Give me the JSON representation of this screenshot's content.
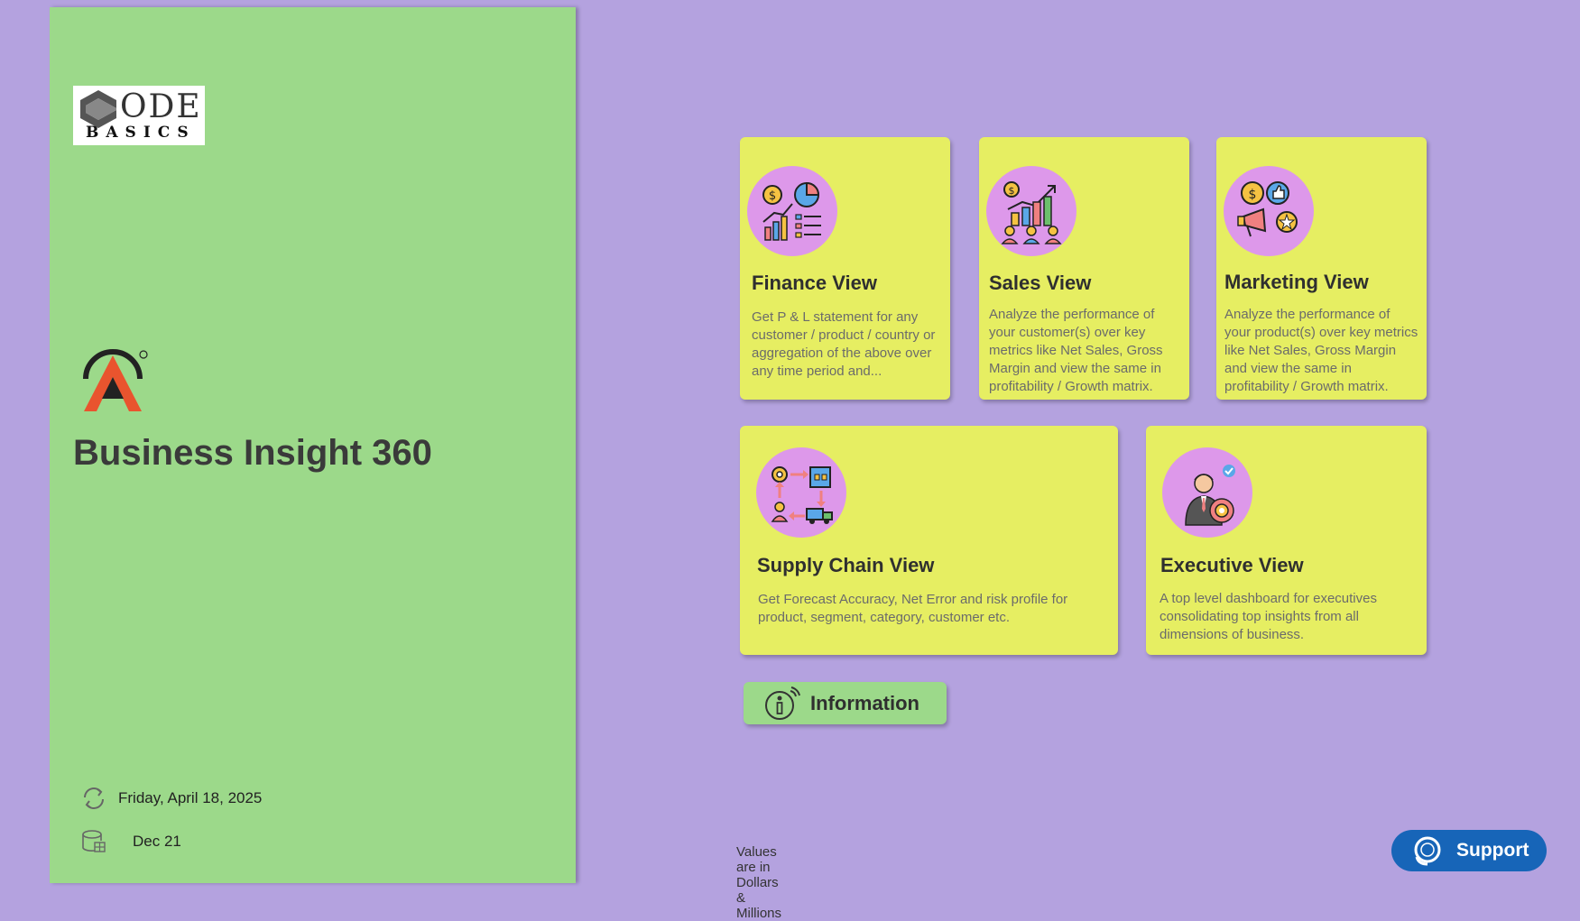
{
  "sidebar": {
    "logo": {
      "line1": "ODE",
      "line2": "BASICS"
    },
    "app_title": "Business Insight 360",
    "refresh_date": "Friday, April 18, 2025",
    "data_date": "Dec 21"
  },
  "cards": {
    "finance": {
      "title": "Finance View",
      "desc": "Get P & L statement for any customer / product / country or aggregation of the above over any time period and...",
      "icon": "finance-chart-icon"
    },
    "sales": {
      "title": "Sales View",
      "desc": "Analyze the performance of your customer(s) over key metrics like Net Sales, Gross Margin and view the same in profitability / Growth matrix.",
      "icon": "sales-growth-icon"
    },
    "marketing": {
      "title": "Marketing View",
      "desc": "Analyze the performance of your product(s) over key metrics like Net Sales, Gross Margin and view the same in profitability / Growth matrix.",
      "icon": "marketing-megaphone-icon"
    },
    "supply_chain": {
      "title": "Supply Chain View",
      "desc": "Get Forecast Accuracy, Net Error and risk profile for product, segment, category, customer etc.",
      "icon": "supply-chain-icon"
    },
    "executive": {
      "title": "Executive View",
      "desc": "A top level dashboard for executives consolidating top insights from all dimensions of business.",
      "icon": "executive-icon"
    }
  },
  "info_button": {
    "label": "Information"
  },
  "footnote": "Values are in Dollars & Millions",
  "support_button": {
    "label": "Support"
  },
  "colors": {
    "background": "#b4a2df",
    "sidebar": "#9cd98a",
    "card": "#e6ee62",
    "icon_circle": "#dd98ea",
    "support": "#1765b8"
  }
}
